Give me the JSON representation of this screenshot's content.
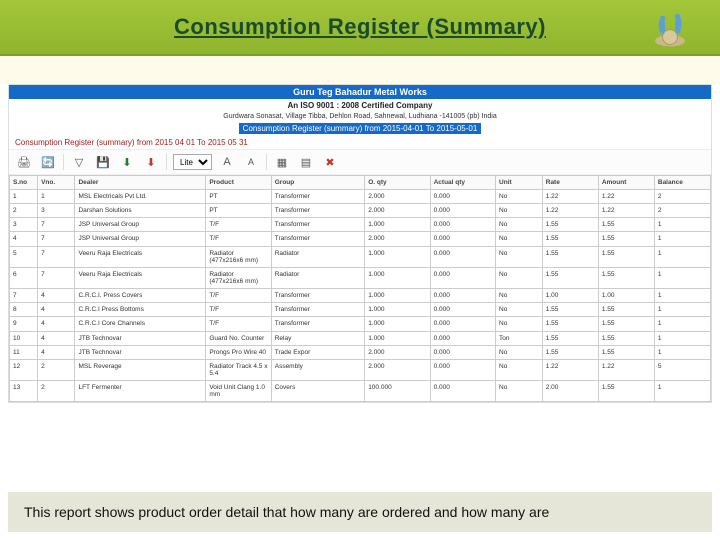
{
  "header": {
    "title": "Consumption Register (Summary)"
  },
  "report": {
    "company": "Guru Teg Bahadur Metal Works",
    "cert": "An ISO 9001 : 2008 Certified Company",
    "address": "Gurdwara Sonasat, Village Tibba, Dehlon Road, Sahnewal, Ludhiana -141005 (pb) India",
    "subtitle": "Consumption Register (summary) from 2015-04-01 To 2015-05-01",
    "range": "Consumption Register (summary) from 2015 04 01 To 2015 05 31"
  },
  "toolbar": {
    "font_value": "Lite",
    "icons": {
      "print": "print-icon",
      "refresh": "refresh-icon",
      "filter": "filter-icon",
      "export_xls": "export-xls-icon",
      "export_pdf": "export-pdf-icon",
      "font_a": "font-a-icon",
      "font_b": "font-b-icon",
      "layout": "layout-icon",
      "grid": "grid-icon",
      "close": "close-icon",
      "save": "save-icon"
    }
  },
  "columns": [
    "S.no",
    "Vno.",
    "Dealer",
    "Product",
    "Group",
    "O. qty",
    "Actual qty",
    "Unit",
    "Rate",
    "Amount",
    "Balance"
  ],
  "rows": [
    {
      "sno": "1",
      "vno": "1",
      "dealer": "MSL Electricals Pvt Ltd.",
      "prod": "PT",
      "group": "Transformer",
      "oqty": "2.000",
      "aqty": "0.000",
      "unit": "No",
      "rate": "1.22",
      "amt": "1.22",
      "bal": "2"
    },
    {
      "sno": "2",
      "vno": "3",
      "dealer": "Darshan Solutions",
      "prod": "PT",
      "group": "Transformer",
      "oqty": "2.000",
      "aqty": "0.000",
      "unit": "No",
      "rate": "1.22",
      "amt": "1.22",
      "bal": "2"
    },
    {
      "sno": "3",
      "vno": "7",
      "dealer": "JSP Universal Group",
      "prod": "T/F",
      "group": "Transformer",
      "oqty": "1.000",
      "aqty": "0.000",
      "unit": "No",
      "rate": "1.55",
      "amt": "1.55",
      "bal": "1"
    },
    {
      "sno": "4",
      "vno": "7",
      "dealer": "JSP Universal Group",
      "prod": "T/F",
      "group": "Transformer",
      "oqty": "2.000",
      "aqty": "0.000",
      "unit": "No",
      "rate": "1.55",
      "amt": "1.55",
      "bal": "1"
    },
    {
      "sno": "5",
      "vno": "7",
      "dealer": "Veeru Raja Electricals",
      "prod": "Radiator (477x216x6 mm)",
      "group": "Radiator",
      "oqty": "1.000",
      "aqty": "0.000",
      "unit": "No",
      "rate": "1.55",
      "amt": "1.55",
      "bal": "1"
    },
    {
      "sno": "6",
      "vno": "7",
      "dealer": "Veeru Raja Electricals",
      "prod": "Radiator (477x216x6 mm)",
      "group": "Radiator",
      "oqty": "1.000",
      "aqty": "0.000",
      "unit": "No",
      "rate": "1.55",
      "amt": "1.55",
      "bal": "1"
    },
    {
      "sno": "7",
      "vno": "4",
      "dealer": "C.R.C.I. Press Covers",
      "prod": "T/F",
      "group": "Transformer",
      "oqty": "1.000",
      "aqty": "0.000",
      "unit": "No",
      "rate": "1.00",
      "amt": "1.00",
      "bal": "1"
    },
    {
      "sno": "8",
      "vno": "4",
      "dealer": "C.R.C.I Press Bottoms",
      "prod": "T/F",
      "group": "Transformer",
      "oqty": "1.000",
      "aqty": "0.000",
      "unit": "No",
      "rate": "1.55",
      "amt": "1.55",
      "bal": "1"
    },
    {
      "sno": "9",
      "vno": "4",
      "dealer": "C.R.C.I Core Channels",
      "prod": "T/F",
      "group": "Transformer",
      "oqty": "1.000",
      "aqty": "0.000",
      "unit": "No",
      "rate": "1.55",
      "amt": "1.55",
      "bal": "1"
    },
    {
      "sno": "10",
      "vno": "4",
      "dealer": "JTB Technovar",
      "prod": "Guard No. Counter",
      "group": "Relay",
      "oqty": "1.000",
      "aqty": "0.000",
      "unit": "Ton",
      "rate": "1.55",
      "amt": "1.55",
      "bal": "1"
    },
    {
      "sno": "11",
      "vno": "4",
      "dealer": "JTB Technovar",
      "prod": "Prongs Pro Wire 40",
      "group": "Trade Expor",
      "oqty": "2.000",
      "aqty": "0.000",
      "unit": "No",
      "rate": "1.55",
      "amt": "1.55",
      "bal": "1"
    },
    {
      "sno": "12",
      "vno": "2",
      "dealer": "MSL Reverage",
      "prod": "Radiator Track 4.5 x 5.4",
      "group": "Assembly",
      "oqty": "2.000",
      "aqty": "0.000",
      "unit": "No",
      "rate": "1.22",
      "amt": "1.22",
      "bal": "5"
    },
    {
      "sno": "13",
      "vno": "2",
      "dealer": "LFT Fermenter",
      "prod": "Void Unit Clang 1.0 mm",
      "group": "Covers",
      "oqty": "100.000",
      "aqty": "0.000",
      "unit": "No",
      "rate": "2.00",
      "amt": "1.55",
      "bal": "1"
    }
  ],
  "footer": {
    "text": "This report shows product order detail that how many are ordered and how many are"
  }
}
